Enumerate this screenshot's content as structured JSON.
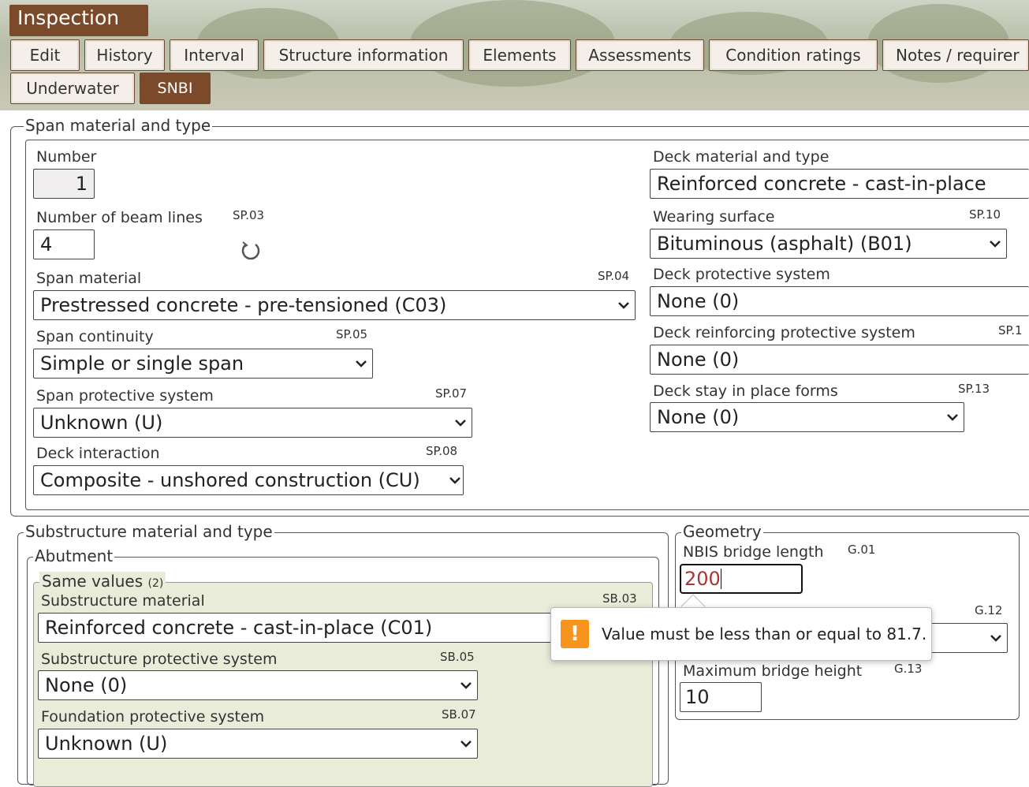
{
  "header": {
    "title": "Inspection"
  },
  "tabs": [
    {
      "label": "Edit"
    },
    {
      "label": "History"
    },
    {
      "label": "Interval"
    },
    {
      "label": "Structure information"
    },
    {
      "label": "Elements"
    },
    {
      "label": "Assessments"
    },
    {
      "label": "Condition ratings"
    },
    {
      "label": "Notes / requirer"
    },
    {
      "label": "Underwater"
    },
    {
      "label": "SNBI"
    }
  ],
  "active_tab": "SNBI",
  "span": {
    "legend": "Span material and type",
    "number": {
      "label": "Number",
      "value": "1"
    },
    "beam_lines": {
      "label": "Number of beam lines",
      "code": "SP.03",
      "value": "4"
    },
    "material": {
      "label": "Span material",
      "code": "SP.04",
      "value": "Prestressed concrete - pre-tensioned (C03)"
    },
    "continuity": {
      "label": "Span continuity",
      "code": "SP.05",
      "value": "Simple or single span"
    },
    "protective": {
      "label": "Span protective system",
      "code": "SP.07",
      "value": "Unknown (U)"
    },
    "deck_interaction": {
      "label": "Deck interaction",
      "code": "SP.08",
      "value": "Composite - unshored construction (CU)"
    },
    "deck_material": {
      "label": "Deck material and type",
      "value": "Reinforced concrete - cast-in-place"
    },
    "wearing": {
      "label": "Wearing surface",
      "code": "SP.10",
      "value": "Bituminous (asphalt) (B01)"
    },
    "deck_protective": {
      "label": "Deck protective system",
      "value": "None (0)"
    },
    "deck_reinforcing": {
      "label": "Deck reinforcing protective system",
      "code": "SP.1",
      "value": "None (0)"
    },
    "deck_stay": {
      "label": "Deck stay in place forms",
      "code": "SP.13",
      "value": "None (0)"
    }
  },
  "substructure": {
    "legend": "Substructure material and type",
    "abutment_legend": "Abutment",
    "same_values": "Same values",
    "same_count": "(2)",
    "material": {
      "label": "Substructure material",
      "code": "SB.03",
      "value": "Reinforced concrete - cast-in-place (C01)"
    },
    "protective": {
      "label": "Substructure protective system",
      "code": "SB.05",
      "value": "None (0)"
    },
    "foundation": {
      "label": "Foundation protective system",
      "code": "SB.07",
      "value": "Unknown (U)"
    }
  },
  "geometry": {
    "legend": "Geometry",
    "nbis_length": {
      "label": "NBIS bridge length",
      "code": "G.01",
      "value": "200"
    },
    "g12_code": "G.12",
    "max_height": {
      "label": "Maximum bridge height",
      "code": "G.13",
      "value": "10"
    }
  },
  "tooltip": {
    "message": "Value must be less than or equal to 81.7."
  }
}
